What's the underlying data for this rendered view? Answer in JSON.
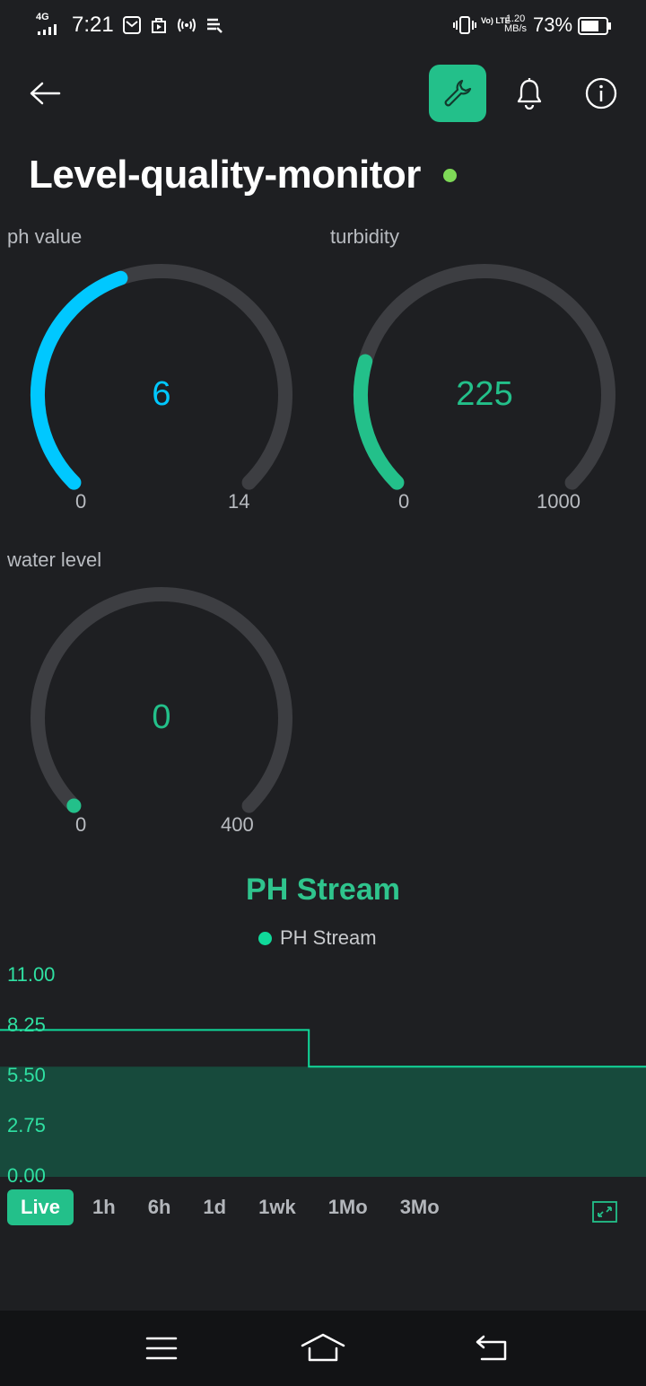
{
  "status_bar": {
    "network": "4G",
    "time": "7:21",
    "volte": "Vo) LTE",
    "speed_value": "1.20",
    "speed_unit": "MB/s",
    "battery_percent": "73%",
    "battery_level": 0.73
  },
  "header": {
    "back_icon": "arrow-left-icon",
    "wrench_icon": "wrench-icon",
    "bell_icon": "bell-icon",
    "info_icon": "info-icon",
    "accent_color": "#23c08a"
  },
  "device": {
    "title": "Level-quality-monitor",
    "online_color": "#7ed957"
  },
  "gauges": [
    {
      "label": "ph value",
      "value": "6",
      "min": "0",
      "max": "14",
      "fraction": 0.4286,
      "color": "#00c8ff"
    },
    {
      "label": "turbidity",
      "value": "225",
      "min": "0",
      "max": "1000",
      "fraction": 0.225,
      "color": "#23c08a"
    },
    {
      "label": "water level",
      "value": "0",
      "min": "0",
      "max": "400",
      "fraction": 0.0,
      "color": "#23c08a"
    }
  ],
  "chart": {
    "title": "PH Stream",
    "legend": "PH Stream",
    "range_buttons": [
      "Live",
      "1h",
      "6h",
      "1d",
      "1wk",
      "1Mo",
      "3Mo"
    ],
    "active_range": "Live",
    "expand_icon": "expand-icon",
    "line_color": "#10d99a",
    "fill_color": "#174a3c"
  },
  "chart_data": {
    "type": "area",
    "title": "PH Stream",
    "series": [
      {
        "name": "PH Stream",
        "x": [
          0,
          0.478,
          0.478,
          1.0
        ],
        "values": [
          8.0,
          8.0,
          6.0,
          6.0
        ]
      }
    ],
    "yticks": [
      "11.00",
      "8.25",
      "5.50",
      "2.75",
      "0.00"
    ],
    "ylim": [
      0,
      11
    ],
    "grid": false,
    "legend_position": "top-center"
  },
  "nav_bar": {
    "menu_icon": "menu-icon",
    "home_icon": "home-icon",
    "back_icon": "back-return-icon"
  }
}
